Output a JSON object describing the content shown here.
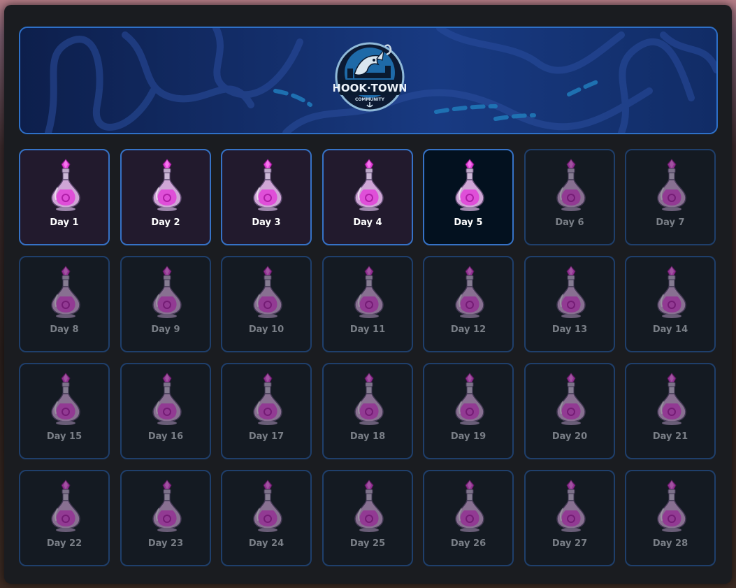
{
  "banner": {
    "logo_title": "HOOK·TOWN",
    "logo_subtitle": "COMMUNITY"
  },
  "colors": {
    "claimed_bg": "#221a2d",
    "current_bg": "#03111f",
    "locked_bg": "#141a22",
    "accent_border": "#3672c6",
    "potion": "#e23fd8"
  },
  "reward_icon": "potion-icon",
  "days": [
    {
      "label": "Day 1",
      "state": "claimed"
    },
    {
      "label": "Day 2",
      "state": "claimed"
    },
    {
      "label": "Day 3",
      "state": "claimed"
    },
    {
      "label": "Day 4",
      "state": "claimed"
    },
    {
      "label": "Day 5",
      "state": "current"
    },
    {
      "label": "Day 6",
      "state": "locked"
    },
    {
      "label": "Day 7",
      "state": "locked"
    },
    {
      "label": "Day 8",
      "state": "locked"
    },
    {
      "label": "Day 9",
      "state": "locked"
    },
    {
      "label": "Day 10",
      "state": "locked"
    },
    {
      "label": "Day 11",
      "state": "locked"
    },
    {
      "label": "Day 12",
      "state": "locked"
    },
    {
      "label": "Day 13",
      "state": "locked"
    },
    {
      "label": "Day 14",
      "state": "locked"
    },
    {
      "label": "Day 15",
      "state": "locked"
    },
    {
      "label": "Day 16",
      "state": "locked"
    },
    {
      "label": "Day 17",
      "state": "locked"
    },
    {
      "label": "Day 18",
      "state": "locked"
    },
    {
      "label": "Day 19",
      "state": "locked"
    },
    {
      "label": "Day 20",
      "state": "locked"
    },
    {
      "label": "Day 21",
      "state": "locked"
    },
    {
      "label": "Day 22",
      "state": "locked"
    },
    {
      "label": "Day 23",
      "state": "locked"
    },
    {
      "label": "Day 24",
      "state": "locked"
    },
    {
      "label": "Day 25",
      "state": "locked"
    },
    {
      "label": "Day 26",
      "state": "locked"
    },
    {
      "label": "Day 27",
      "state": "locked"
    },
    {
      "label": "Day 28",
      "state": "locked"
    }
  ]
}
